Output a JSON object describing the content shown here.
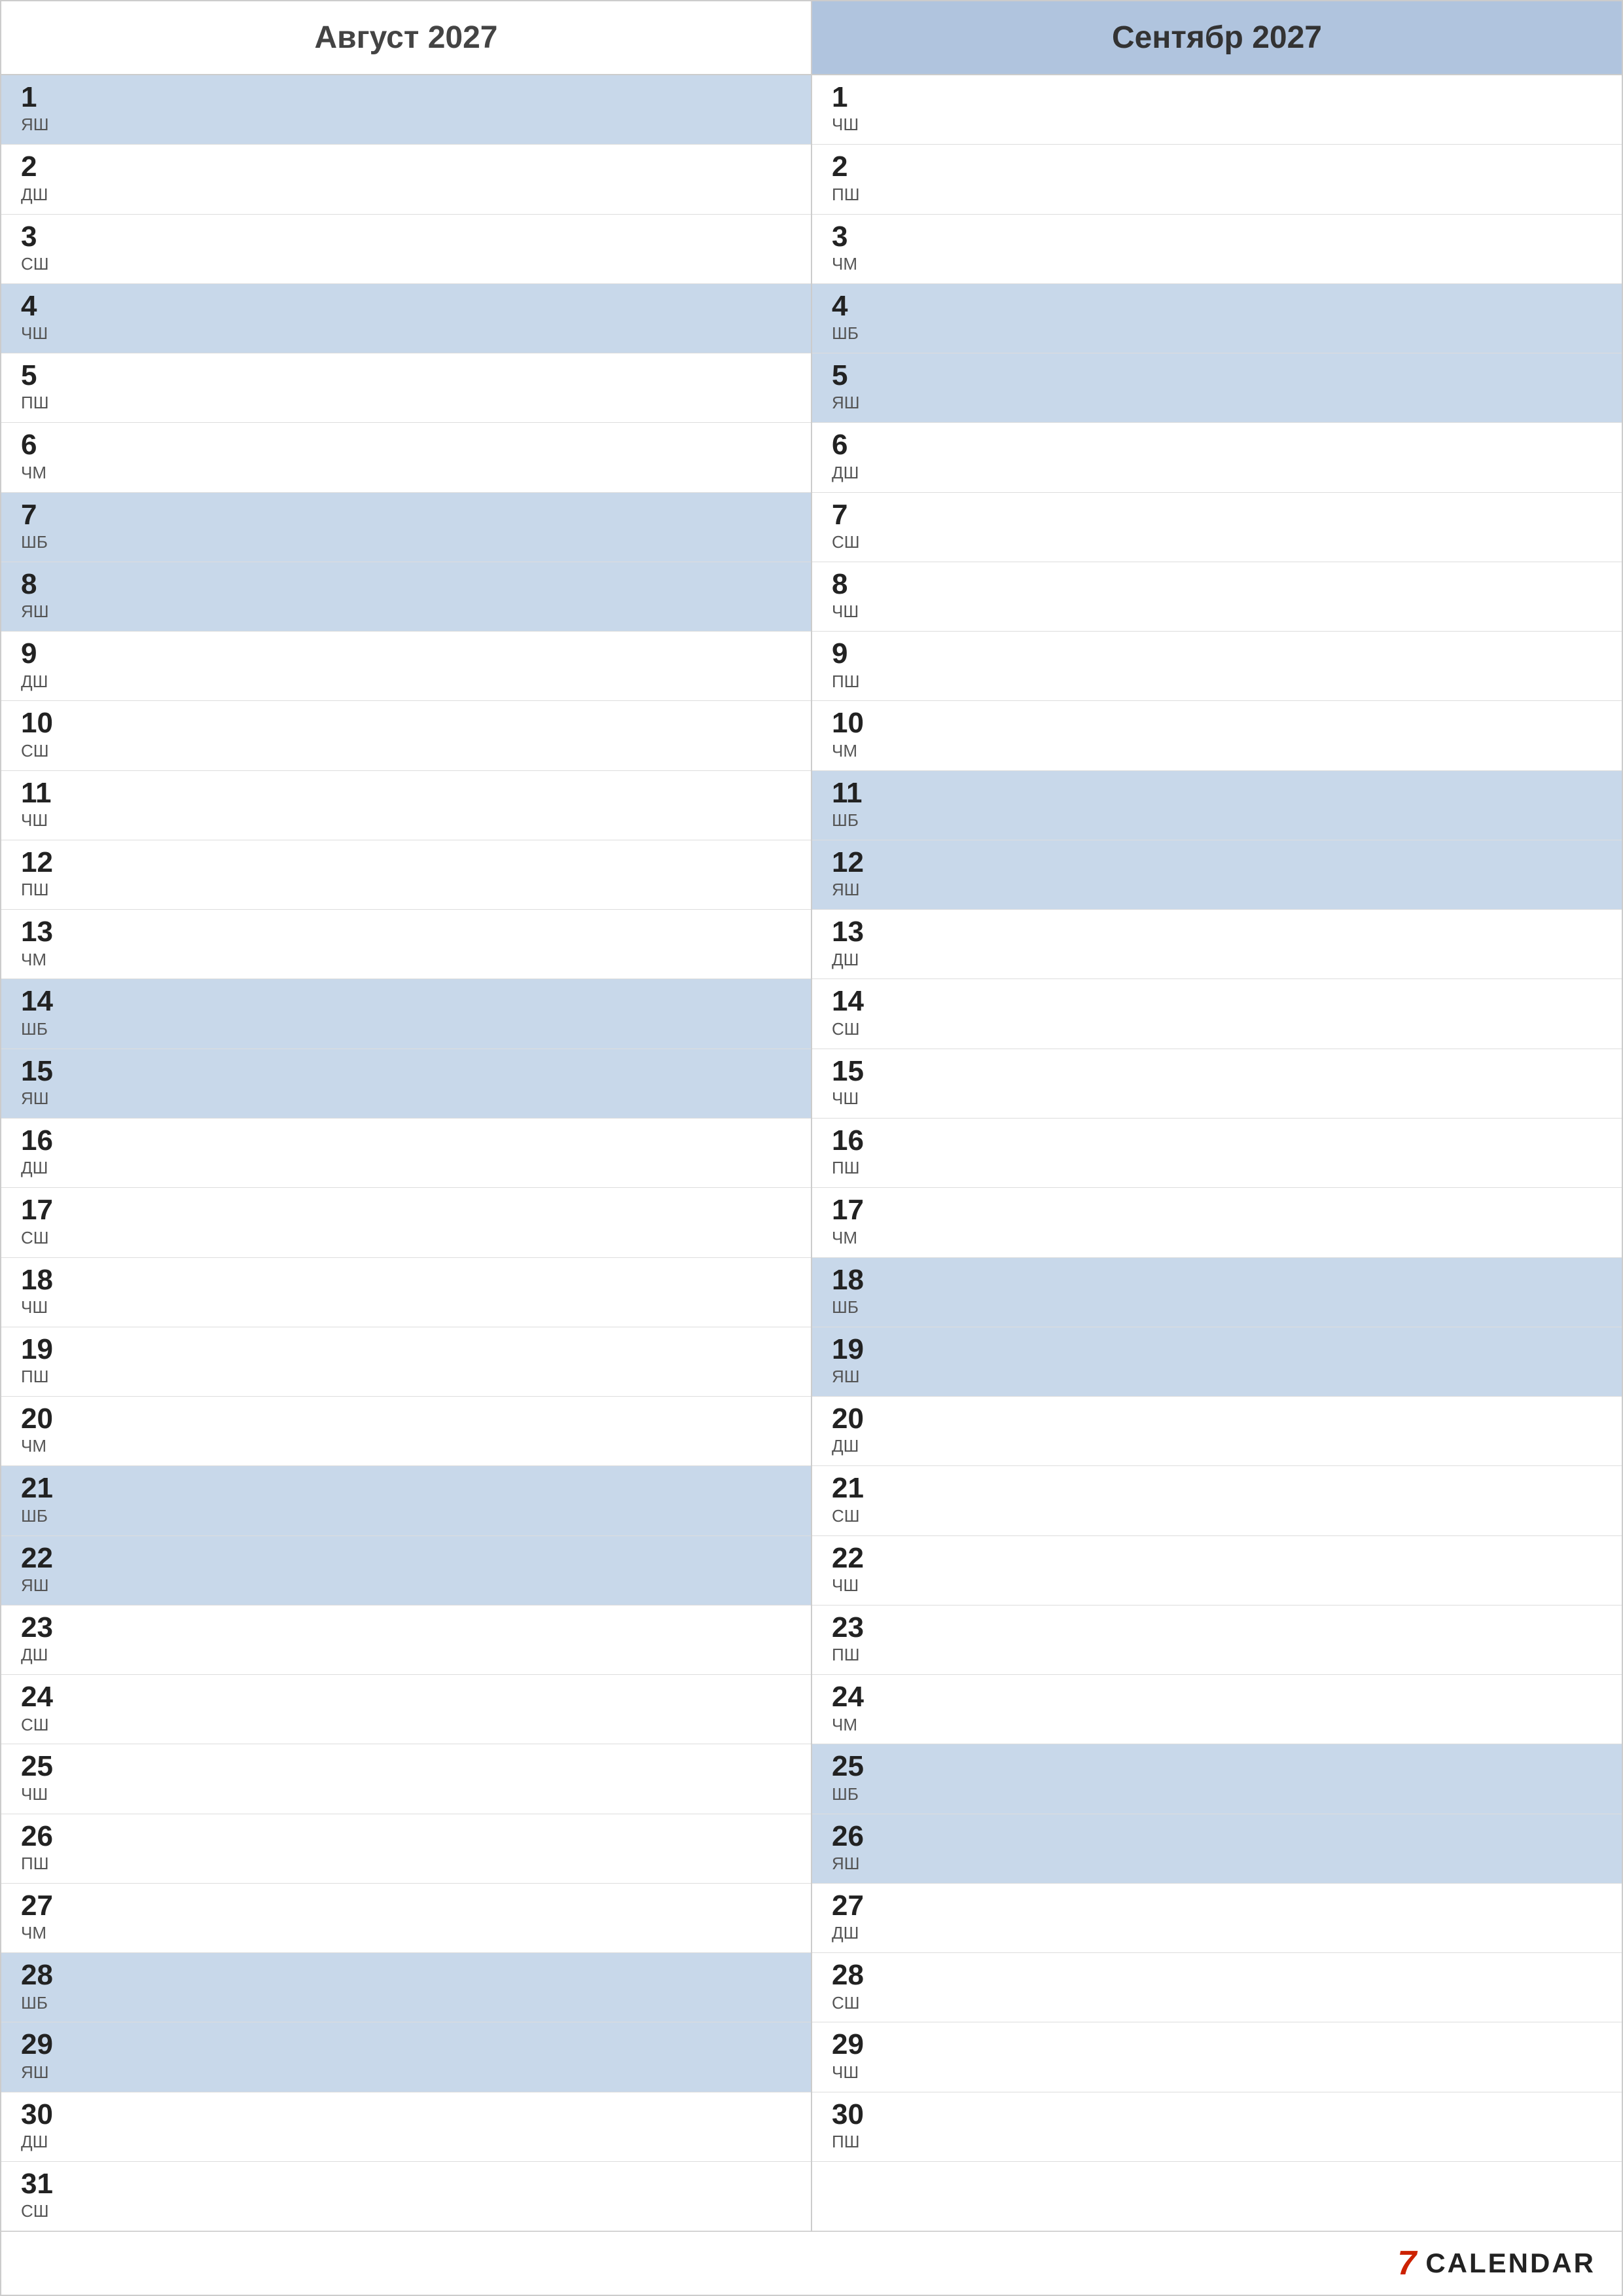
{
  "header": {
    "aug_label": "Август 2027",
    "sep_label": "Сентябр 2027"
  },
  "august": [
    {
      "num": "1",
      "abbr": "ЯШ",
      "highlight": true
    },
    {
      "num": "2",
      "abbr": "ДШ",
      "highlight": false
    },
    {
      "num": "3",
      "abbr": "СШ",
      "highlight": false
    },
    {
      "num": "4",
      "abbr": "ЧШ",
      "highlight": true
    },
    {
      "num": "5",
      "abbr": "ПШ",
      "highlight": false
    },
    {
      "num": "6",
      "abbr": "ЧМ",
      "highlight": false
    },
    {
      "num": "7",
      "abbr": "ШБ",
      "highlight": true
    },
    {
      "num": "8",
      "abbr": "ЯШ",
      "highlight": true
    },
    {
      "num": "9",
      "abbr": "ДШ",
      "highlight": false
    },
    {
      "num": "10",
      "abbr": "СШ",
      "highlight": false
    },
    {
      "num": "11",
      "abbr": "ЧШ",
      "highlight": false
    },
    {
      "num": "12",
      "abbr": "ПШ",
      "highlight": false
    },
    {
      "num": "13",
      "abbr": "ЧМ",
      "highlight": false
    },
    {
      "num": "14",
      "abbr": "ШБ",
      "highlight": true
    },
    {
      "num": "15",
      "abbr": "ЯШ",
      "highlight": true
    },
    {
      "num": "16",
      "abbr": "ДШ",
      "highlight": false
    },
    {
      "num": "17",
      "abbr": "СШ",
      "highlight": false
    },
    {
      "num": "18",
      "abbr": "ЧШ",
      "highlight": false
    },
    {
      "num": "19",
      "abbr": "ПШ",
      "highlight": false
    },
    {
      "num": "20",
      "abbr": "ЧМ",
      "highlight": false
    },
    {
      "num": "21",
      "abbr": "ШБ",
      "highlight": true
    },
    {
      "num": "22",
      "abbr": "ЯШ",
      "highlight": true
    },
    {
      "num": "23",
      "abbr": "ДШ",
      "highlight": false
    },
    {
      "num": "24",
      "abbr": "СШ",
      "highlight": false
    },
    {
      "num": "25",
      "abbr": "ЧШ",
      "highlight": false
    },
    {
      "num": "26",
      "abbr": "ПШ",
      "highlight": false
    },
    {
      "num": "27",
      "abbr": "ЧМ",
      "highlight": false
    },
    {
      "num": "28",
      "abbr": "ШБ",
      "highlight": true
    },
    {
      "num": "29",
      "abbr": "ЯШ",
      "highlight": true
    },
    {
      "num": "30",
      "abbr": "ДШ",
      "highlight": false
    },
    {
      "num": "31",
      "abbr": "СШ",
      "highlight": false
    }
  ],
  "september": [
    {
      "num": "1",
      "abbr": "ЧШ",
      "highlight": false
    },
    {
      "num": "2",
      "abbr": "ПШ",
      "highlight": false
    },
    {
      "num": "3",
      "abbr": "ЧМ",
      "highlight": false
    },
    {
      "num": "4",
      "abbr": "ШБ",
      "highlight": true
    },
    {
      "num": "5",
      "abbr": "ЯШ",
      "highlight": true
    },
    {
      "num": "6",
      "abbr": "ДШ",
      "highlight": false
    },
    {
      "num": "7",
      "abbr": "СШ",
      "highlight": false
    },
    {
      "num": "8",
      "abbr": "ЧШ",
      "highlight": false
    },
    {
      "num": "9",
      "abbr": "ПШ",
      "highlight": false
    },
    {
      "num": "10",
      "abbr": "ЧМ",
      "highlight": false
    },
    {
      "num": "11",
      "abbr": "ШБ",
      "highlight": true
    },
    {
      "num": "12",
      "abbr": "ЯШ",
      "highlight": true
    },
    {
      "num": "13",
      "abbr": "ДШ",
      "highlight": false
    },
    {
      "num": "14",
      "abbr": "СШ",
      "highlight": false
    },
    {
      "num": "15",
      "abbr": "ЧШ",
      "highlight": false
    },
    {
      "num": "16",
      "abbr": "ПШ",
      "highlight": false
    },
    {
      "num": "17",
      "abbr": "ЧМ",
      "highlight": false
    },
    {
      "num": "18",
      "abbr": "ШБ",
      "highlight": true
    },
    {
      "num": "19",
      "abbr": "ЯШ",
      "highlight": true
    },
    {
      "num": "20",
      "abbr": "ДШ",
      "highlight": false
    },
    {
      "num": "21",
      "abbr": "СШ",
      "highlight": false
    },
    {
      "num": "22",
      "abbr": "ЧШ",
      "highlight": false
    },
    {
      "num": "23",
      "abbr": "ПШ",
      "highlight": false
    },
    {
      "num": "24",
      "abbr": "ЧМ",
      "highlight": false
    },
    {
      "num": "25",
      "abbr": "ШБ",
      "highlight": true
    },
    {
      "num": "26",
      "abbr": "ЯШ",
      "highlight": true
    },
    {
      "num": "27",
      "abbr": "ДШ",
      "highlight": false
    },
    {
      "num": "28",
      "abbr": "СШ",
      "highlight": false
    },
    {
      "num": "29",
      "abbr": "ЧШ",
      "highlight": false
    },
    {
      "num": "30",
      "abbr": "ПШ",
      "highlight": false
    }
  ],
  "brand": {
    "icon": "7",
    "text": "CALENDAR"
  }
}
